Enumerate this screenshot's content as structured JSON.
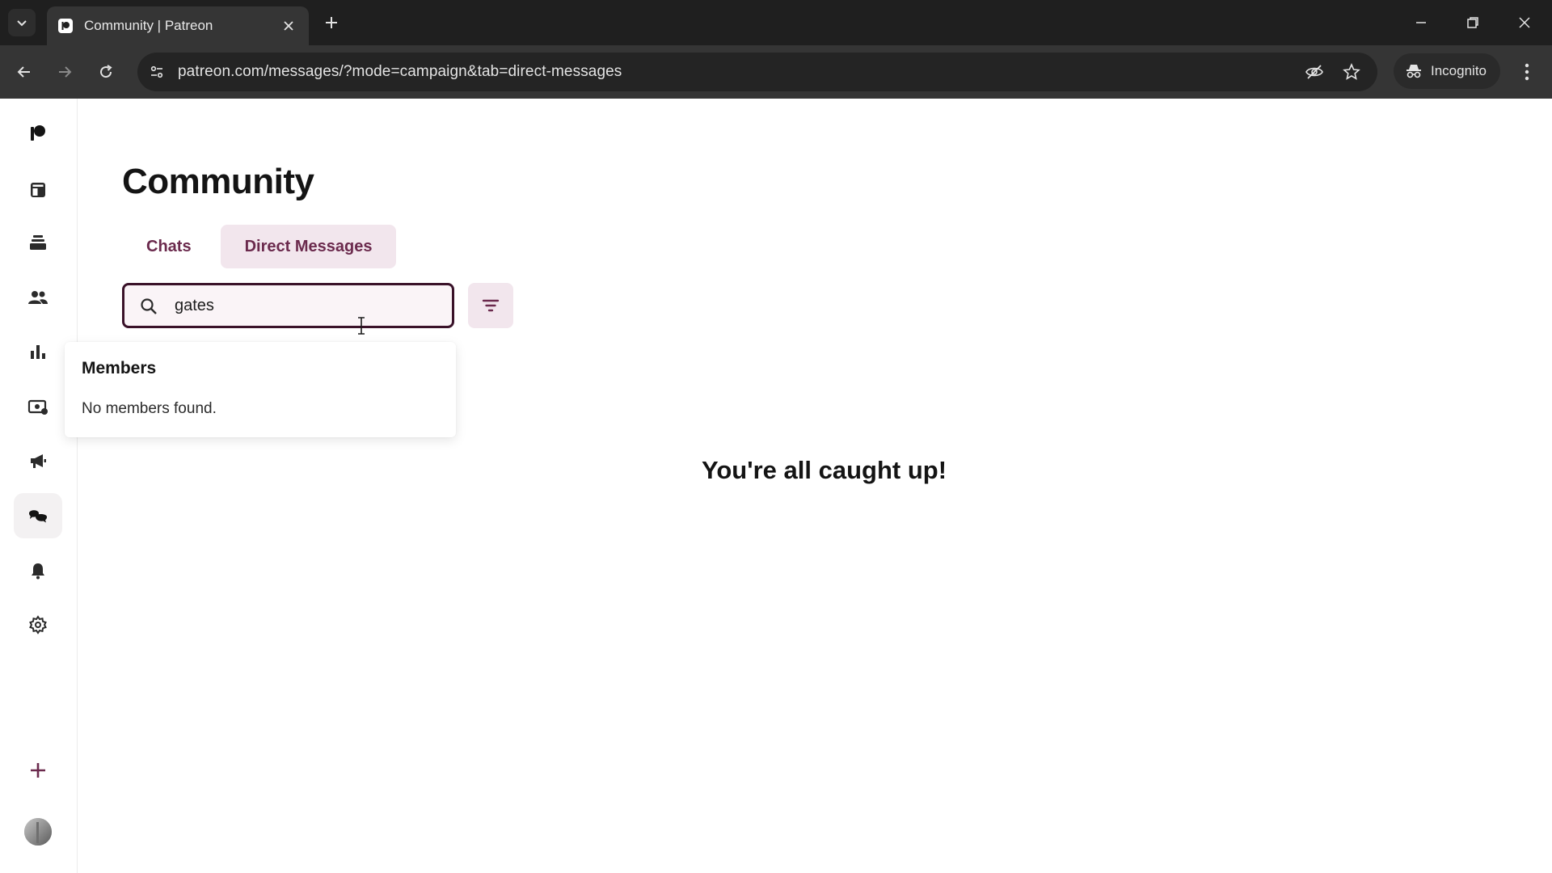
{
  "browser": {
    "tab_title": "Community | Patreon",
    "url": "patreon.com/messages/?mode=campaign&tab=direct-messages",
    "incognito_label": "Incognito"
  },
  "sidebar": {
    "items": [
      {
        "name": "patreon-logo"
      },
      {
        "name": "home"
      },
      {
        "name": "library"
      },
      {
        "name": "audience"
      },
      {
        "name": "insights"
      },
      {
        "name": "payouts"
      },
      {
        "name": "promotions"
      },
      {
        "name": "community",
        "active": true
      },
      {
        "name": "notifications"
      },
      {
        "name": "settings"
      }
    ]
  },
  "main": {
    "title": "Community",
    "tabs": [
      {
        "label": "Chats",
        "active": false
      },
      {
        "label": "Direct Messages",
        "active": true
      }
    ],
    "search": {
      "value": "gates"
    },
    "dropdown": {
      "heading": "Members",
      "empty_text": "No members found."
    },
    "empty_state": "You're all caught up!"
  },
  "colors": {
    "accent_dark": "#3a1229",
    "accent_tint": "#f2e6ed",
    "tab_text": "#6b2a4d"
  }
}
